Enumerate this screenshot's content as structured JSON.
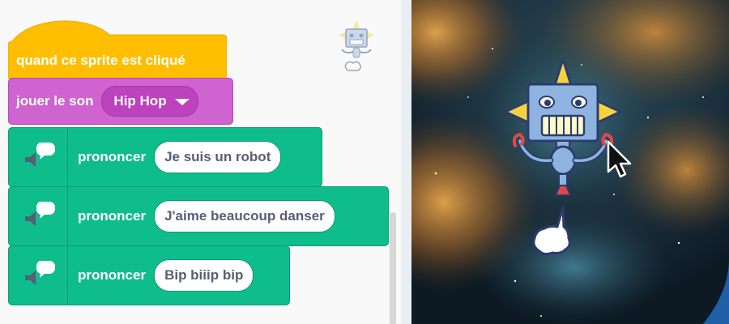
{
  "blocks": {
    "hat_label": "quand ce sprite est cliqué",
    "sound_label": "jouer le son",
    "sound_value": "Hip Hop",
    "say_label": "prononcer",
    "say_1": "Je suis un robot",
    "say_2": "J'aime beaucoup danser",
    "say_3": "Bip biiip bip"
  },
  "icons": {
    "speech": "speech-bubble-icon",
    "speaker": "speaker-icon",
    "dropdown": "chevron-down-icon",
    "cursor": "mouse-pointer-icon"
  },
  "colors": {
    "events": "#ffbf00",
    "sound": "#cf63cf",
    "looks_ext": "#0fbd8c",
    "text": "#575e75"
  }
}
